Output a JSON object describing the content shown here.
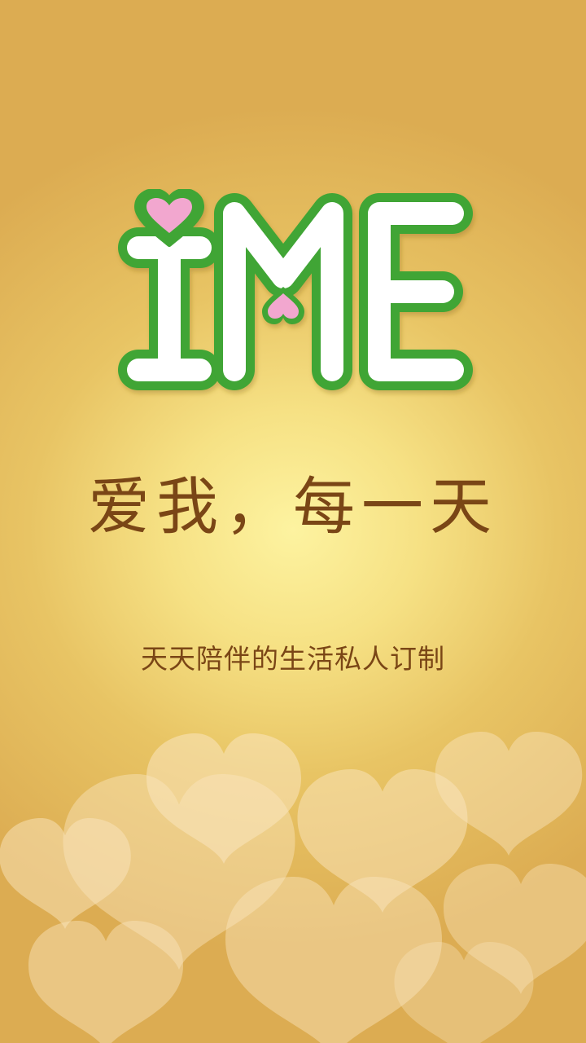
{
  "app": {
    "logo_text": "iME",
    "tagline": "爱我，每一天",
    "subtitle": "天天陪伴的生活私人订制"
  },
  "colors": {
    "logo_fill": "#ffffff",
    "logo_outline": "#3fa535",
    "heart_pink": "#f2a7cf",
    "text_brown": "#7a4616"
  },
  "icons": [
    "ime-logo",
    "pink-heart-icon",
    "heart-pattern-decoration"
  ]
}
